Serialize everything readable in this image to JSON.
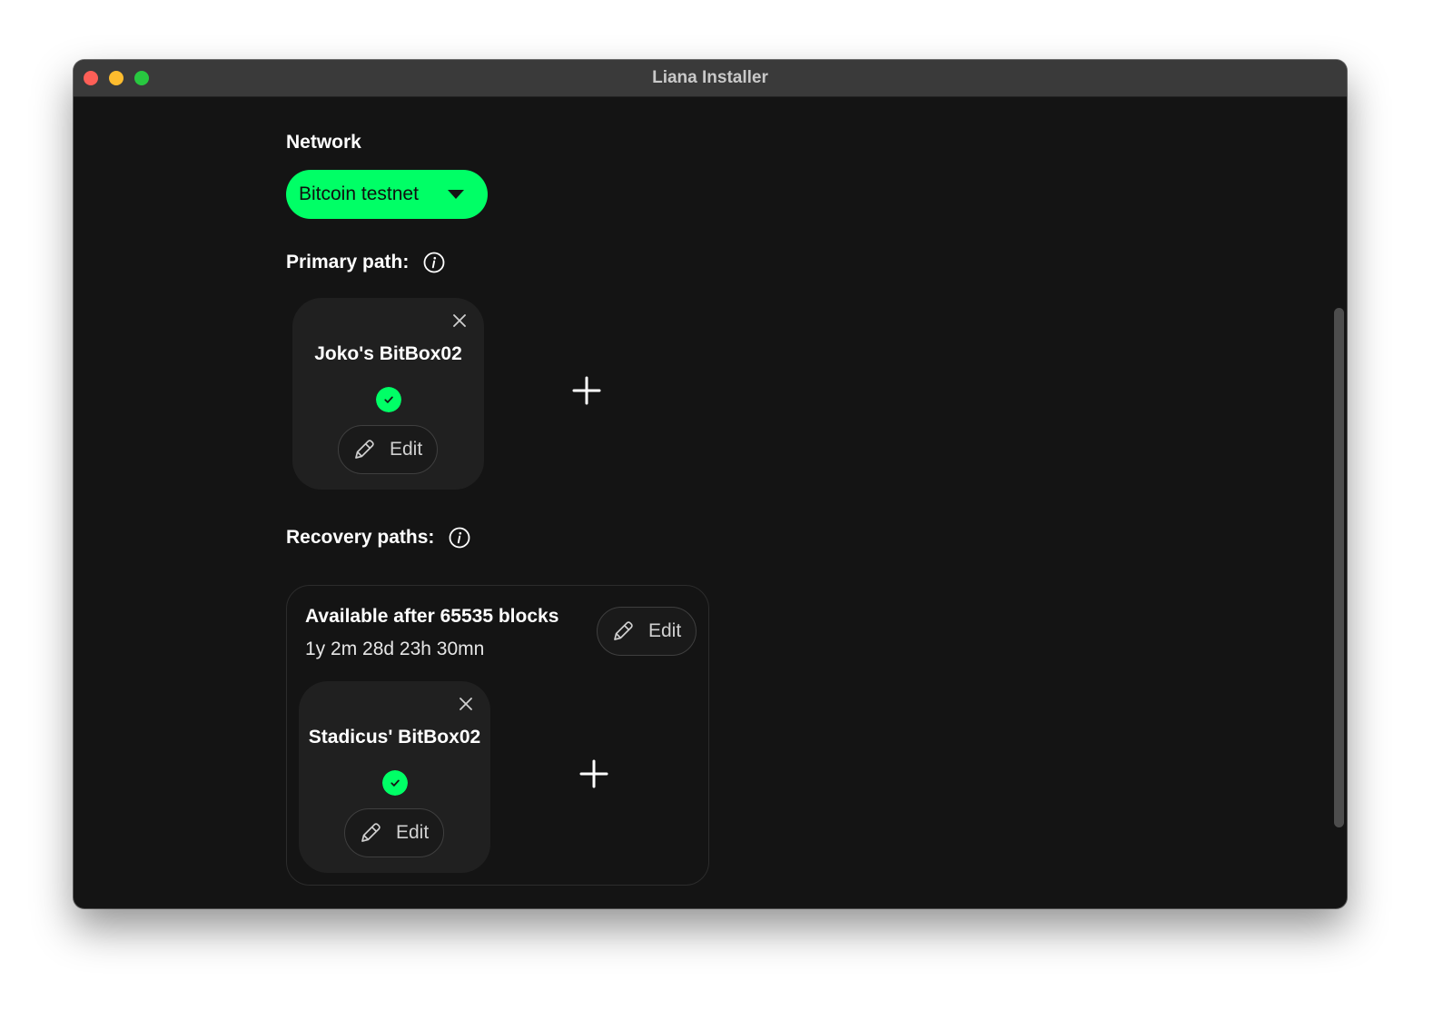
{
  "window": {
    "title": "Liana Installer"
  },
  "colors": {
    "accent": "#00ff66",
    "background": "#141414",
    "card": "#202020",
    "close": "#fe5f57",
    "minimize": "#febc2e",
    "maximize": "#28c840"
  },
  "network": {
    "label": "Network",
    "selected": "Bitcoin testnet"
  },
  "primary": {
    "label": "Primary path:",
    "info_icon": "info-icon",
    "keys": [
      {
        "name": "Joko's BitBox02",
        "status_icon": "check-icon",
        "edit_label": "Edit"
      }
    ]
  },
  "recovery": {
    "label": "Recovery paths:",
    "info_icon": "info-icon",
    "paths": [
      {
        "title": "Available after 65535 blocks",
        "duration": "1y 2m 28d 23h 30mn",
        "edit_label": "Edit",
        "keys": [
          {
            "name": "Stadicus' BitBox02",
            "status_icon": "check-icon",
            "edit_label": "Edit"
          }
        ]
      }
    ]
  }
}
